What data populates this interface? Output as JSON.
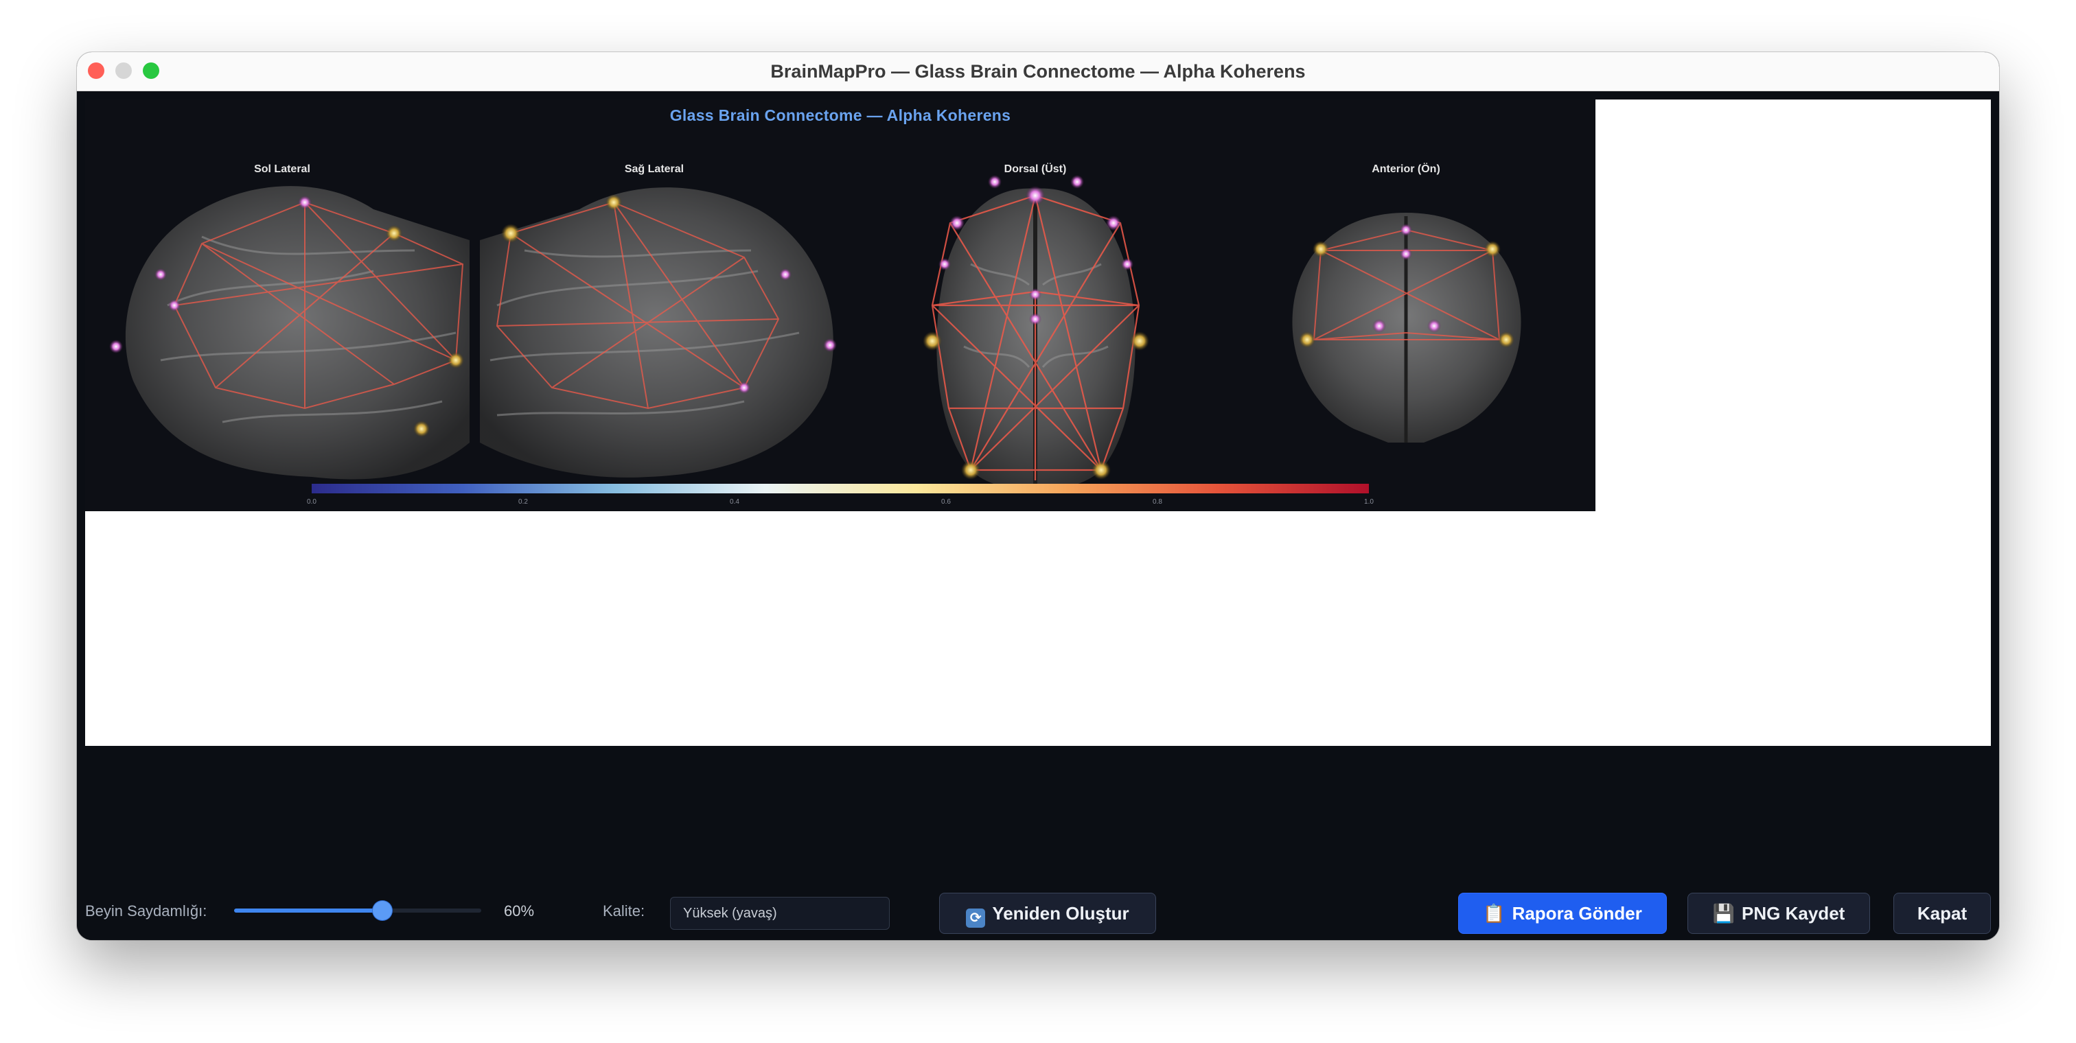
{
  "window": {
    "title": "BrainMapPro — Glass Brain Connectome — Alpha Koherens"
  },
  "figure": {
    "title": "Glass Brain Connectome — Alpha Koherens",
    "panels": [
      {
        "label": "Sol Lateral"
      },
      {
        "label": "Sağ Lateral"
      },
      {
        "label": "Dorsal (Üst)"
      },
      {
        "label": "Anterior (Ön)"
      }
    ],
    "colorbar": {
      "ticks": [
        "0.0",
        "0.2",
        "0.4",
        "0.6",
        "0.8",
        "1.0"
      ],
      "colors": [
        "#2c2c8c",
        "#4060c0",
        "#86bde0",
        "#eaf3f5",
        "#fbe89c",
        "#f6a55b",
        "#e5543a",
        "#b0102a"
      ]
    }
  },
  "controls": {
    "transparency_label": "Beyin Saydamlığı:",
    "transparency_value": "60%",
    "transparency_fraction": 0.6,
    "quality_label": "Kalite:",
    "quality_value": "Yüksek (yavaş)",
    "regenerate_label": "Yeniden Oluştur",
    "send_report_label": "Rapora Gönder",
    "save_png_label": "PNG Kaydet",
    "close_label": "Kapat"
  },
  "colors": {
    "accent": "#1f5ef0",
    "title_blue": "#6aa3ef",
    "edge_red": "#f05a4a"
  }
}
